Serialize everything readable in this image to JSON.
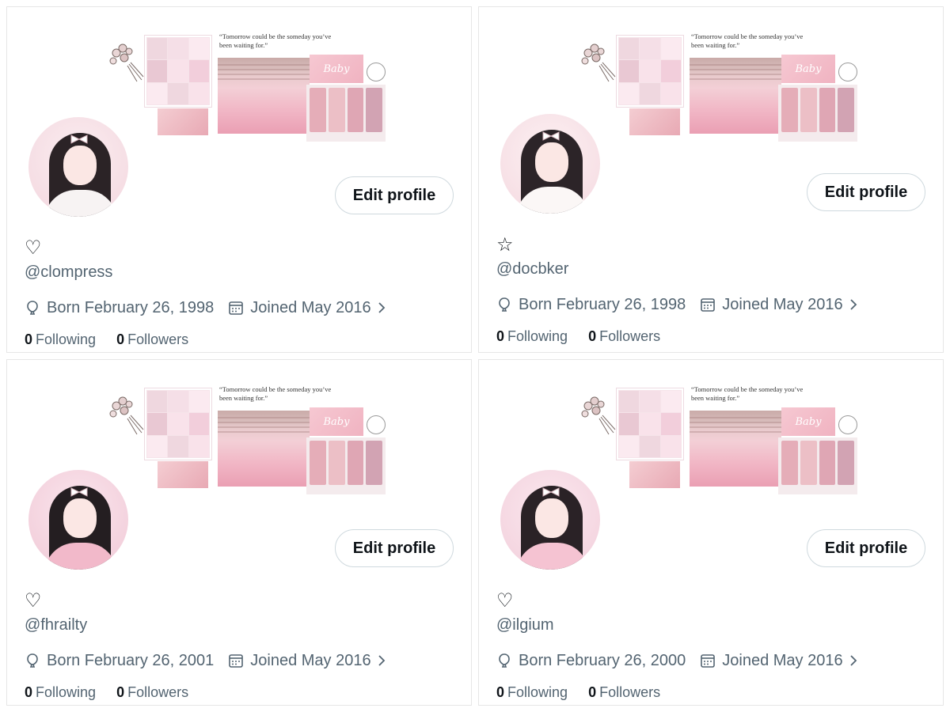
{
  "banner_quote": "“Tomorrow could be the someday you’ve been waiting for.”",
  "banner_card_text": "Baby",
  "colors": {
    "text_primary": "#0f1419",
    "text_secondary": "#536471",
    "button_border": "#cfd9de",
    "pink_accent": "#f1b6c5"
  },
  "profiles": [
    {
      "display_name": "♡",
      "handle": "@clompress",
      "born": "Born February 26, 1998",
      "joined": "Joined May 2016",
      "following_count": "0",
      "following_label": "Following",
      "followers_count": "0",
      "followers_label": "Followers",
      "edit_label": "Edit profile",
      "avatar_icon": "avatar-girl-white-sweater"
    },
    {
      "display_name": "☆",
      "handle": "@docbker",
      "born": "Born February 26, 1998",
      "joined": "Joined May 2016",
      "following_count": "0",
      "following_label": "Following",
      "followers_count": "0",
      "followers_label": "Followers",
      "edit_label": "Edit profile",
      "avatar_icon": "avatar-girl-bear-ears"
    },
    {
      "display_name": "♡",
      "handle": "@fhrailty",
      "born": "Born February 26, 2001",
      "joined": "Joined May 2016",
      "following_count": "0",
      "following_label": "Following",
      "followers_count": "0",
      "followers_label": "Followers",
      "edit_label": "Edit profile",
      "avatar_icon": "avatar-girl-pink-bow"
    },
    {
      "display_name": "♡",
      "handle": "@ilgium",
      "born": "Born February 26, 2000",
      "joined": "Joined May 2016",
      "following_count": "0",
      "following_label": "Following",
      "followers_count": "0",
      "followers_label": "Followers",
      "edit_label": "Edit profile",
      "avatar_icon": "avatar-girl-pink-outfit"
    }
  ]
}
